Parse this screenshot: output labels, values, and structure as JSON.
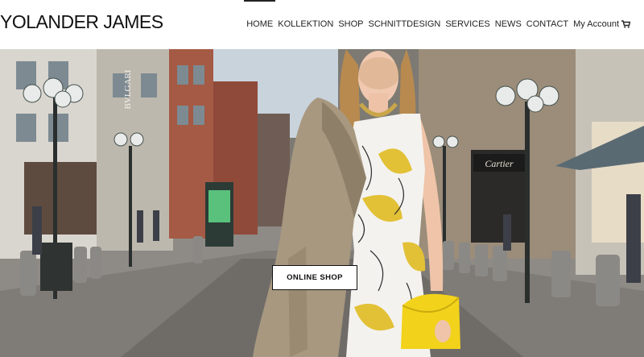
{
  "brand": {
    "logo_text": "YOLANDER JAMES"
  },
  "nav": {
    "items": [
      {
        "label": "HOME",
        "active": true
      },
      {
        "label": "KOLLEKTION"
      },
      {
        "label": "SHOP"
      },
      {
        "label": "SCHNITTDESIGN"
      },
      {
        "label": "SERVICES"
      },
      {
        "label": "NEWS"
      },
      {
        "label": "CONTACT"
      },
      {
        "label": "My Account"
      }
    ],
    "cart_icon": "shopping-cart-icon"
  },
  "hero": {
    "cta_label": "ONLINE SHOP",
    "storefront_signs": {
      "left": "BVLGARI",
      "right": "Cartier"
    }
  },
  "colors": {
    "nav_text": "#222222",
    "dress_yellow": "#e8c93a",
    "clutch_yellow": "#f2d21b",
    "coat": "#a89880"
  }
}
